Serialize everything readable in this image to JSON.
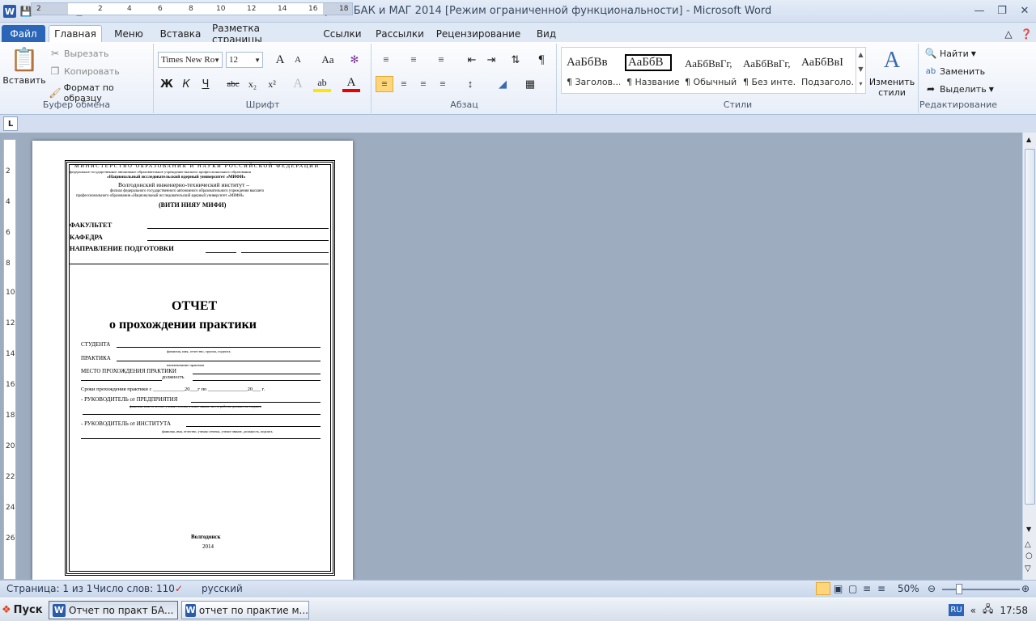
{
  "window": {
    "title": "Отчет по практ БАК и МАГ 2014 [Режим ограниченной функциональности]  -  Microsoft Word",
    "app_icon_letter": "W"
  },
  "tabs": [
    {
      "label": "Файл"
    },
    {
      "label": "Главная"
    },
    {
      "label": "Меню"
    },
    {
      "label": "Вставка"
    },
    {
      "label": "Разметка страницы"
    },
    {
      "label": "Ссылки"
    },
    {
      "label": "Рассылки"
    },
    {
      "label": "Рецензирование"
    },
    {
      "label": "Вид"
    }
  ],
  "clipboard": {
    "group": "Буфер обмена",
    "paste": "Вставить",
    "cut": "Вырезать",
    "copy": "Копировать",
    "format_painter": "Формат по образцу"
  },
  "font": {
    "group": "Шрифт",
    "name": "Times New Ro",
    "size": "12",
    "bold": "Ж",
    "italic": "К",
    "underline": "Ч",
    "strike": "abc",
    "subscript": "x₂",
    "superscript": "x²",
    "change_case": "Aa",
    "grow": "A",
    "shrink": "A"
  },
  "paragraph": {
    "group": "Абзац",
    "pilcrow": "¶"
  },
  "styles": {
    "group": "Стили",
    "items": [
      {
        "preview": "АаБбВв",
        "name": "¶ Заголов..."
      },
      {
        "preview": "АаБбВ",
        "name": "¶ Название"
      },
      {
        "preview": "АаБбВвГг,",
        "name": "¶ Обычный"
      },
      {
        "preview": "АаБбВвГг,",
        "name": "¶ Без инте..."
      },
      {
        "preview": "АаБбВвI",
        "name": "Подзаголо..."
      }
    ],
    "change": "Изменить стили"
  },
  "editing": {
    "group": "Редактирование",
    "find": "Найти",
    "replace": "Заменить",
    "select": "Выделить"
  },
  "ruler": {
    "h_labels": [
      "2",
      "2",
      "4",
      "6",
      "8",
      "10",
      "12",
      "14",
      "16",
      "18"
    ],
    "v_labels": [
      "2",
      "4",
      "6",
      "8",
      "10",
      "12",
      "14",
      "16",
      "18",
      "20",
      "22",
      "24",
      "26"
    ],
    "tab_marker": "L"
  },
  "document": {
    "ministry": "МИНИСТЕРСТВО ОБРАЗОВАНИЯ И НАУКИ РОССИЙСКОЙ ФЕДЕРАЦИИ",
    "federal": "федеральное государственное автономное образовательное учреждение высшего профессионального образования",
    "university": "«Национальный исследовательский ядерный университет «МИФИ»",
    "institute": "Волгодонский инженерно-технический институт –",
    "branch1": "филиал федерального государственного автономного образовательного учреждения высшего",
    "branch2": "профессионального образования «Национальный исследовательский ядерный университет «МИФИ»",
    "abbr": "(ВИТИ НИЯУ МИФИ)",
    "faculty": "ФАКУЛЬТЕТ",
    "department": "КАФЕДРА",
    "direction": "НАПРАВЛЕНИЕ ПОДГОТОВКИ",
    "title1": "ОТЧЕТ",
    "title2": "о прохождении практики",
    "student": "СТУДЕНТА",
    "student_hint": "фамилия, имя, отчество, группа, подпись",
    "practice": "ПРАКТИКА",
    "practice_hint": "наименование практики",
    "place": "МЕСТО ПРОХОЖДЕНИЯ ПРАКТИКИ",
    "position": "должность",
    "dates": "Сроки прохождения практики с ____________20___г по _______________20___ г.",
    "head_company": "- РУКОВОДИТЕЛЬ от ПРЕДПРИЯТИЯ",
    "head_company_hint": "фамилия, имя, отчество, ученая степень, ученое звание, место работы, должность, подпись",
    "head_institute": "- РУКОВОДИТЕЛЬ от ИНСТИТУТА",
    "head_institute_hint": "фамилия, имя, отчество, ученая степень, ученое звание, должность, подпись",
    "city": "Волгодонск",
    "year": "2014"
  },
  "status": {
    "page": "Страница: 1 из 1",
    "words": "Число слов: 110",
    "language": "русский",
    "zoom": "50%"
  },
  "taskbar": {
    "start": "Пуск",
    "tasks": [
      {
        "label": "Отчет по практ БА..."
      },
      {
        "label": "отчет по практие м..."
      }
    ],
    "lang": "RU",
    "time": "17:58"
  }
}
